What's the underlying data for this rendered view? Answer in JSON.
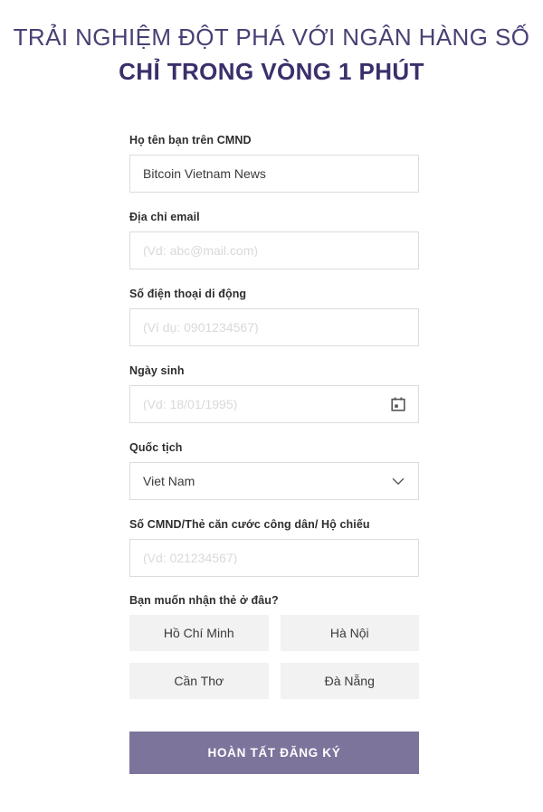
{
  "heading": {
    "line1": "TRẢI NGHIỆM ĐỘT PHÁ VỚI NGÂN HÀNG SỐ",
    "line2": "CHỈ TRONG VÒNG 1 PHÚT",
    "color_line1": "#4a4074",
    "color_line2": "#3b2f6b"
  },
  "form": {
    "fields": [
      {
        "label": "Họ tên bạn trên CMND",
        "value": "Bitcoin Vietnam News",
        "placeholder": "",
        "icon": ""
      },
      {
        "label": "Địa chỉ email",
        "value": "",
        "placeholder": "(Vd: abc@mail.com)",
        "icon": ""
      },
      {
        "label": "Số điện thoại di động",
        "value": "",
        "placeholder": "(Ví dụ: 0901234567)",
        "icon": ""
      },
      {
        "label": "Ngày sinh",
        "value": "",
        "placeholder": "(Vd: 18/01/1995)",
        "icon": "calendar-icon"
      },
      {
        "label": "Quốc tịch",
        "value": "Viet Nam",
        "placeholder": "",
        "icon": "chevron-down-icon"
      },
      {
        "label": "Số CMND/Thẻ căn cước công dân/ Hộ chiếu",
        "value": "",
        "placeholder": "(Vd: 021234567)",
        "icon": ""
      }
    ],
    "delivery": {
      "label": "Bạn muốn nhận thẻ ở đâu?",
      "options": [
        "Hồ Chí Minh",
        "Hà Nội",
        "Cần Thơ",
        "Đà Nẵng"
      ],
      "option_background": "#f2f2f2"
    },
    "submit": {
      "label": "HOÀN TẤT ĐĂNG KÝ",
      "background": "#7d749c",
      "text_color": "#ffffff"
    }
  }
}
